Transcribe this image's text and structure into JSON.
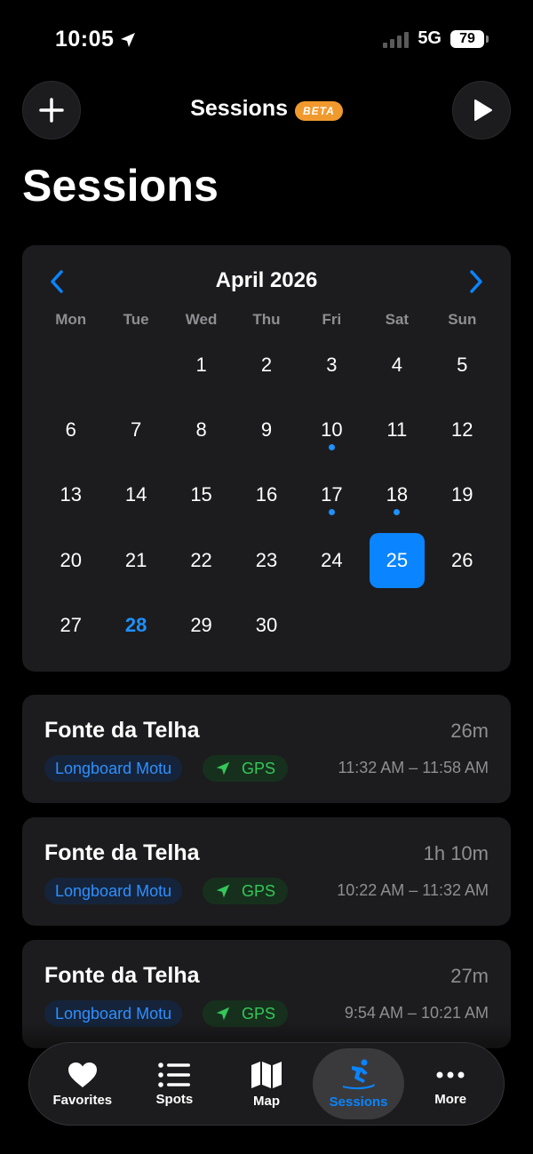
{
  "status_bar": {
    "time": "10:05",
    "network": "5G",
    "battery": "79"
  },
  "header": {
    "title": "Sessions",
    "badge": "BETA",
    "add_icon": "plus-icon",
    "play_icon": "play-icon"
  },
  "page_title": "Sessions",
  "calendar": {
    "month_label": "April 2026",
    "weekdays": [
      "Mon",
      "Tue",
      "Wed",
      "Thu",
      "Fri",
      "Sat",
      "Sun"
    ],
    "leading_blanks": 2,
    "days": [
      "1",
      "2",
      "3",
      "4",
      "5",
      "6",
      "7",
      "8",
      "9",
      "10",
      "11",
      "12",
      "13",
      "14",
      "15",
      "16",
      "17",
      "18",
      "19",
      "20",
      "21",
      "22",
      "23",
      "24",
      "25",
      "26",
      "27",
      "28",
      "29",
      "30"
    ],
    "days_with_sessions": [
      "10",
      "17",
      "18"
    ],
    "selected_day": "25",
    "today": "28"
  },
  "sessions": [
    {
      "spot": "Fonte da Telha",
      "duration": "26m",
      "board": "Longboard Motu",
      "gps_label": "GPS",
      "time_range": "11:32 AM – 11:58 AM"
    },
    {
      "spot": "Fonte da Telha",
      "duration": "1h 10m",
      "board": "Longboard Motu",
      "gps_label": "GPS",
      "time_range": "10:22 AM – 11:32 AM"
    },
    {
      "spot": "Fonte da Telha",
      "duration": "27m",
      "board": "Longboard Motu",
      "gps_label": "GPS",
      "time_range": "9:54 AM – 10:21 AM"
    }
  ],
  "tabbar": {
    "tabs": [
      {
        "label": "Favorites",
        "icon": "heart-icon"
      },
      {
        "label": "Spots",
        "icon": "list-icon"
      },
      {
        "label": "Map",
        "icon": "map-icon"
      },
      {
        "label": "Sessions",
        "icon": "surfer-icon"
      },
      {
        "label": "More",
        "icon": "ellipsis-icon"
      }
    ],
    "active": "Sessions"
  },
  "colors": {
    "accent": "#0a84ff",
    "gps_green": "#34c759",
    "beta_orange": "#f09a2e",
    "card_bg": "#1c1c1e"
  }
}
